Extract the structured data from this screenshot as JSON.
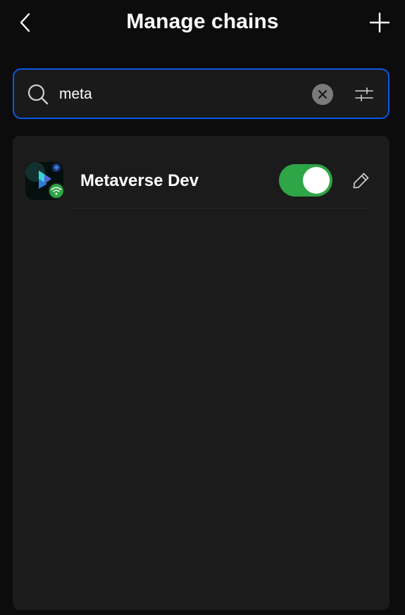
{
  "header": {
    "title": "Manage chains",
    "back_icon": "chevron-left-icon",
    "add_icon": "plus-icon"
  },
  "search": {
    "value": "meta",
    "search_icon": "search-icon",
    "clear_icon": "clear-circle-icon",
    "filter_icon": "sliders-icon"
  },
  "chains": [
    {
      "name": "Metaverse Dev",
      "logo_icon": "metaverse-logo-icon",
      "status_icon": "wifi-status-icon",
      "enabled": true,
      "edit_icon": "pencil-icon"
    }
  ],
  "colors": {
    "background": "#0c0c0c",
    "panel": "#1b1b1b",
    "accent_border": "#0b57e8",
    "toggle_on": "#2ea546",
    "status_green": "#2da547",
    "clear_button": "#7a7a7a"
  }
}
